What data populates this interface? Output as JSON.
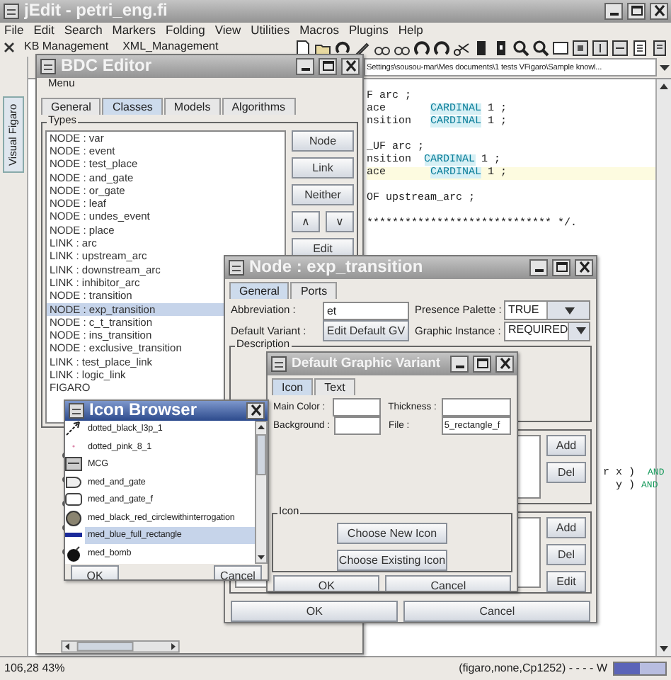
{
  "main_window": {
    "title": "jEdit - petri_eng.fi",
    "menu": [
      "File",
      "Edit",
      "Search",
      "Markers",
      "Folding",
      "View",
      "Utilities",
      "Macros",
      "Plugins",
      "Help"
    ],
    "dock_tabs": [
      "KB Management",
      "XML_Management"
    ],
    "buffer_path": "Settings\\sousou-mar\\Mes documents\\1 tests VFigaro\\Sample knowl...",
    "side_tab": "Visual Figaro",
    "code_blocks": [
      [
        {
          "segments": [
            {
              "text": "F arc ;",
              "kind": "plain"
            }
          ],
          "highlighted": false
        },
        {
          "segments": [
            {
              "text": "ace       ",
              "kind": "plain"
            },
            {
              "text": "CARDINAL",
              "kind": "keyword"
            },
            {
              "text": " 1 ;",
              "kind": "plain"
            }
          ],
          "highlighted": false
        },
        {
          "segments": [
            {
              "text": "nsition   ",
              "kind": "plain"
            },
            {
              "text": "CARDINAL",
              "kind": "keyword"
            },
            {
              "text": " 1 ;",
              "kind": "plain"
            }
          ],
          "highlighted": false
        }
      ],
      [
        {
          "segments": [
            {
              "text": "_UF arc ;",
              "kind": "plain"
            }
          ],
          "highlighted": false
        },
        {
          "segments": [
            {
              "text": "nsition  ",
              "kind": "plain"
            },
            {
              "text": "CARDINAL",
              "kind": "keyword"
            },
            {
              "text": " 1 ;",
              "kind": "plain"
            }
          ],
          "highlighted": false
        },
        {
          "segments": [
            {
              "text": "ace       ",
              "kind": "plain"
            },
            {
              "text": "CARDINAL",
              "kind": "keyword"
            },
            {
              "text": " 1 ;",
              "kind": "plain"
            }
          ],
          "highlighted": true
        }
      ],
      [
        {
          "segments": [
            {
              "text": "OF upstream_arc ;",
              "kind": "plain"
            }
          ],
          "highlighted": false
        }
      ],
      [
        {
          "segments": [
            {
              "text": "***************************** */.",
              "kind": "plain"
            }
          ],
          "highlighted": false
        }
      ]
    ],
    "code_fragments": [
      {
        "segments": [
          {
            "text": "r x )  ",
            "kind": "plain"
          },
          {
            "text": "AND",
            "kind": "operator"
          }
        ],
        "highlighted": false
      },
      {
        "segments": [
          {
            "text": "  y ) ",
            "kind": "plain"
          },
          {
            "text": "AND",
            "kind": "operator"
          }
        ],
        "highlighted": false
      }
    ],
    "status_left": "106,28 43%",
    "status_right": "(figaro,none,Cp1252) - - - - W"
  },
  "bdc_editor": {
    "title": "BDC Editor",
    "menu": "Menu",
    "tabs": [
      {
        "label": "General",
        "selected": false
      },
      {
        "label": "Classes",
        "selected": true
      },
      {
        "label": "Models",
        "selected": false
      },
      {
        "label": "Algorithms",
        "selected": false
      }
    ],
    "types_label": "Types",
    "types": [
      {
        "label": "NODE : var",
        "selected": false
      },
      {
        "label": "NODE : event",
        "selected": false
      },
      {
        "label": "NODE : test_place",
        "selected": false
      },
      {
        "label": "NODE : and_gate",
        "selected": false
      },
      {
        "label": "NODE : or_gate",
        "selected": false
      },
      {
        "label": "NODE : leaf",
        "selected": false
      },
      {
        "label": "NODE : undes_event",
        "selected": false
      },
      {
        "label": "NODE : place",
        "selected": false
      },
      {
        "label": "LINK : arc",
        "selected": false
      },
      {
        "label": "LINK : upstream_arc",
        "selected": false
      },
      {
        "label": "LINK : downstream_arc",
        "selected": false
      },
      {
        "label": "LINK : inhibitor_arc",
        "selected": false
      },
      {
        "label": "NODE : transition",
        "selected": false
      },
      {
        "label": "NODE : exp_transition",
        "selected": true
      },
      {
        "label": "NODE : c_t_transition",
        "selected": false
      },
      {
        "label": "NODE : ins_transition",
        "selected": false
      },
      {
        "label": "NODE : exclusive_transition",
        "selected": false
      },
      {
        "label": "LINK : test_place_link",
        "selected": false
      },
      {
        "label": "LINK : logic_link",
        "selected": false
      },
      {
        "label": "FIGARO",
        "selected": false
      }
    ],
    "buttons": [
      "Node",
      "Link",
      "Neither",
      "∧",
      "∨",
      "Edit"
    ]
  },
  "node_dialog": {
    "title": "Node : exp_transition",
    "tabs": [
      {
        "label": "General",
        "selected": true
      },
      {
        "label": "Ports",
        "selected": false
      }
    ],
    "abbreviation": {
      "label": "Abbreviation :",
      "value": "et"
    },
    "presence_palette": {
      "label": "Presence Palette :",
      "value": "TRUE"
    },
    "default_variant": {
      "label": "Default Variant :",
      "button": "Edit Default GV"
    },
    "graphic_instance": {
      "label": "Graphic Instance :",
      "value": "REQUIRED"
    },
    "description_label": "Description",
    "list_buttons_1": [
      "Add",
      "Del"
    ],
    "list_buttons_2": [
      "Add",
      "Del",
      "Edit"
    ],
    "buttons": [
      "OK",
      "Cancel"
    ]
  },
  "graphic_variant_dialog": {
    "title": "Default Graphic Variant",
    "tabs": [
      {
        "label": "Icon",
        "selected": true
      },
      {
        "label": "Text",
        "selected": false
      }
    ],
    "main_color_label": "Main Color :",
    "thickness_label": "Thickness :",
    "background_label": "Background :",
    "file_label": "File :",
    "file_value": "5_rectangle_f",
    "icon_group_label": "Icon",
    "icon_buttons": [
      "Choose New Icon",
      "Choose Existing Icon"
    ],
    "buttons": [
      "OK",
      "Cancel"
    ]
  },
  "icon_browser": {
    "title": "Icon Browser",
    "items": [
      {
        "label": "dotted_black_l3p_1",
        "kind": "arrow",
        "selected": false
      },
      {
        "label": "dotted_pink_8_1",
        "kind": "dot",
        "selected": false
      },
      {
        "label": "MCG",
        "kind": "mcg",
        "selected": false
      },
      {
        "label": "med_and_gate",
        "kind": "gate",
        "selected": false
      },
      {
        "label": "med_and_gate_f",
        "kind": "et",
        "selected": false
      },
      {
        "label": "med_black_red_circlewithinterrogation",
        "kind": "circle",
        "selected": false
      },
      {
        "label": "med_blue_full_rectangle",
        "kind": "bar",
        "selected": true
      },
      {
        "label": "med_bomb",
        "kind": "bomb",
        "selected": false
      }
    ],
    "buttons": [
      "OK",
      "Cancel"
    ]
  }
}
